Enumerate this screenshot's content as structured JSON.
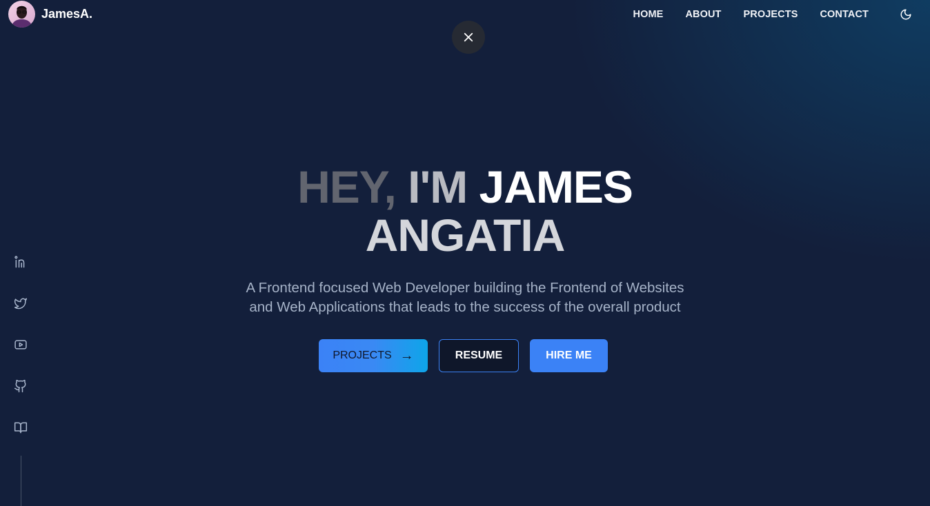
{
  "brand": {
    "name": "JamesA.",
    "avatar_icon": "avatar-photo"
  },
  "nav": {
    "items": [
      {
        "label": "HOME"
      },
      {
        "label": "ABOUT"
      },
      {
        "label": "PROJECTS"
      },
      {
        "label": "CONTACT"
      }
    ],
    "theme_icon": "moon-icon"
  },
  "overlay": {
    "close_icon": "close-icon"
  },
  "hero": {
    "title_line1": [
      "HEY,",
      "I'M",
      "JAMES"
    ],
    "title_line2": "ANGATIA",
    "subtitle_line1": "A Frontend focused Web Developer building the Frontend of Websites",
    "subtitle_line2": "and Web Applications that leads to the success of the overall product",
    "buttons": {
      "projects": "PROJECTS",
      "projects_arrow": "→",
      "resume": "RESUME",
      "hire": "HIRE ME"
    }
  },
  "socials": [
    "linkedin-icon",
    "twitter-icon",
    "youtube-icon",
    "github-icon",
    "book-icon"
  ],
  "colors": {
    "background": "#131f3b",
    "accent": "#3b82f6",
    "accent_alt": "#0ea5e9",
    "subtitle": "#a6b3c8"
  }
}
